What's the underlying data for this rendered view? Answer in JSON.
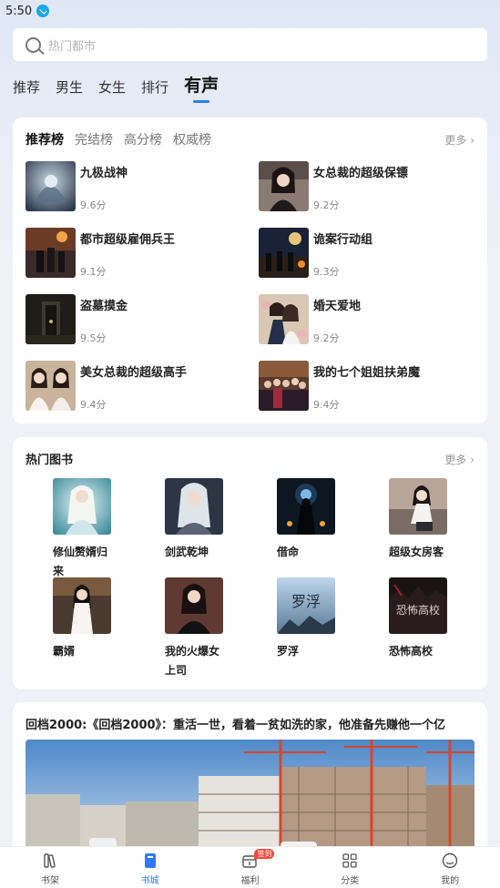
{
  "status": {
    "time": "5:50"
  },
  "search": {
    "placeholder": "热门都市"
  },
  "tabs": [
    {
      "label": "推荐"
    },
    {
      "label": "男生"
    },
    {
      "label": "女生"
    },
    {
      "label": "排行"
    },
    {
      "label": "有声",
      "active": true
    }
  ],
  "rank_card": {
    "tabs": [
      {
        "label": "推荐榜",
        "active": true
      },
      {
        "label": "完结榜"
      },
      {
        "label": "高分榜"
      },
      {
        "label": "权威榜"
      }
    ],
    "more": "更多",
    "items": [
      {
        "title": "九极战神",
        "score": "9.6分"
      },
      {
        "title": "女总裁的超级保镖",
        "score": "9.2分"
      },
      {
        "title": "都市超级雇佣兵王",
        "score": "9.1分"
      },
      {
        "title": "诡案行动组",
        "score": "9.3分"
      },
      {
        "title": "盗墓摸金",
        "score": "9.5分"
      },
      {
        "title": "婚天爱地",
        "score": "9.2分"
      },
      {
        "title": "美女总裁的超级高手",
        "score": "9.4分"
      },
      {
        "title": "我的七个姐姐扶弟魔",
        "score": "9.4分"
      }
    ]
  },
  "hot_card": {
    "title": "热门图书",
    "more": "更多",
    "items": [
      {
        "title": "修仙赘婿归来"
      },
      {
        "title": "剑武乾坤"
      },
      {
        "title": "借命"
      },
      {
        "title": "超级女房客"
      },
      {
        "title": "霸婿"
      },
      {
        "title": "我的火爆女上司"
      },
      {
        "title": "罗浮"
      },
      {
        "title": "恐怖高校"
      }
    ],
    "cover_texts": {
      "luofu": "罗浮",
      "kongbu": "恐怖高校"
    }
  },
  "promo": {
    "title": "回档2000:《回档2000》：重活一世，看着一贫如洗的家，他准备先赚他一个亿"
  },
  "bottom_nav": [
    {
      "label": "书架",
      "icon": "bookshelf-icon"
    },
    {
      "label": "书城",
      "icon": "bookstore-icon",
      "active": true
    },
    {
      "label": "福利",
      "icon": "gift-calendar-icon",
      "badge": "签到"
    },
    {
      "label": "分类",
      "icon": "grid-category-icon"
    },
    {
      "label": "我的",
      "icon": "profile-icon"
    }
  ],
  "colors": {
    "accent": "#2f7bf5",
    "badge": "#f04b3a",
    "background": "#eef1f6"
  }
}
